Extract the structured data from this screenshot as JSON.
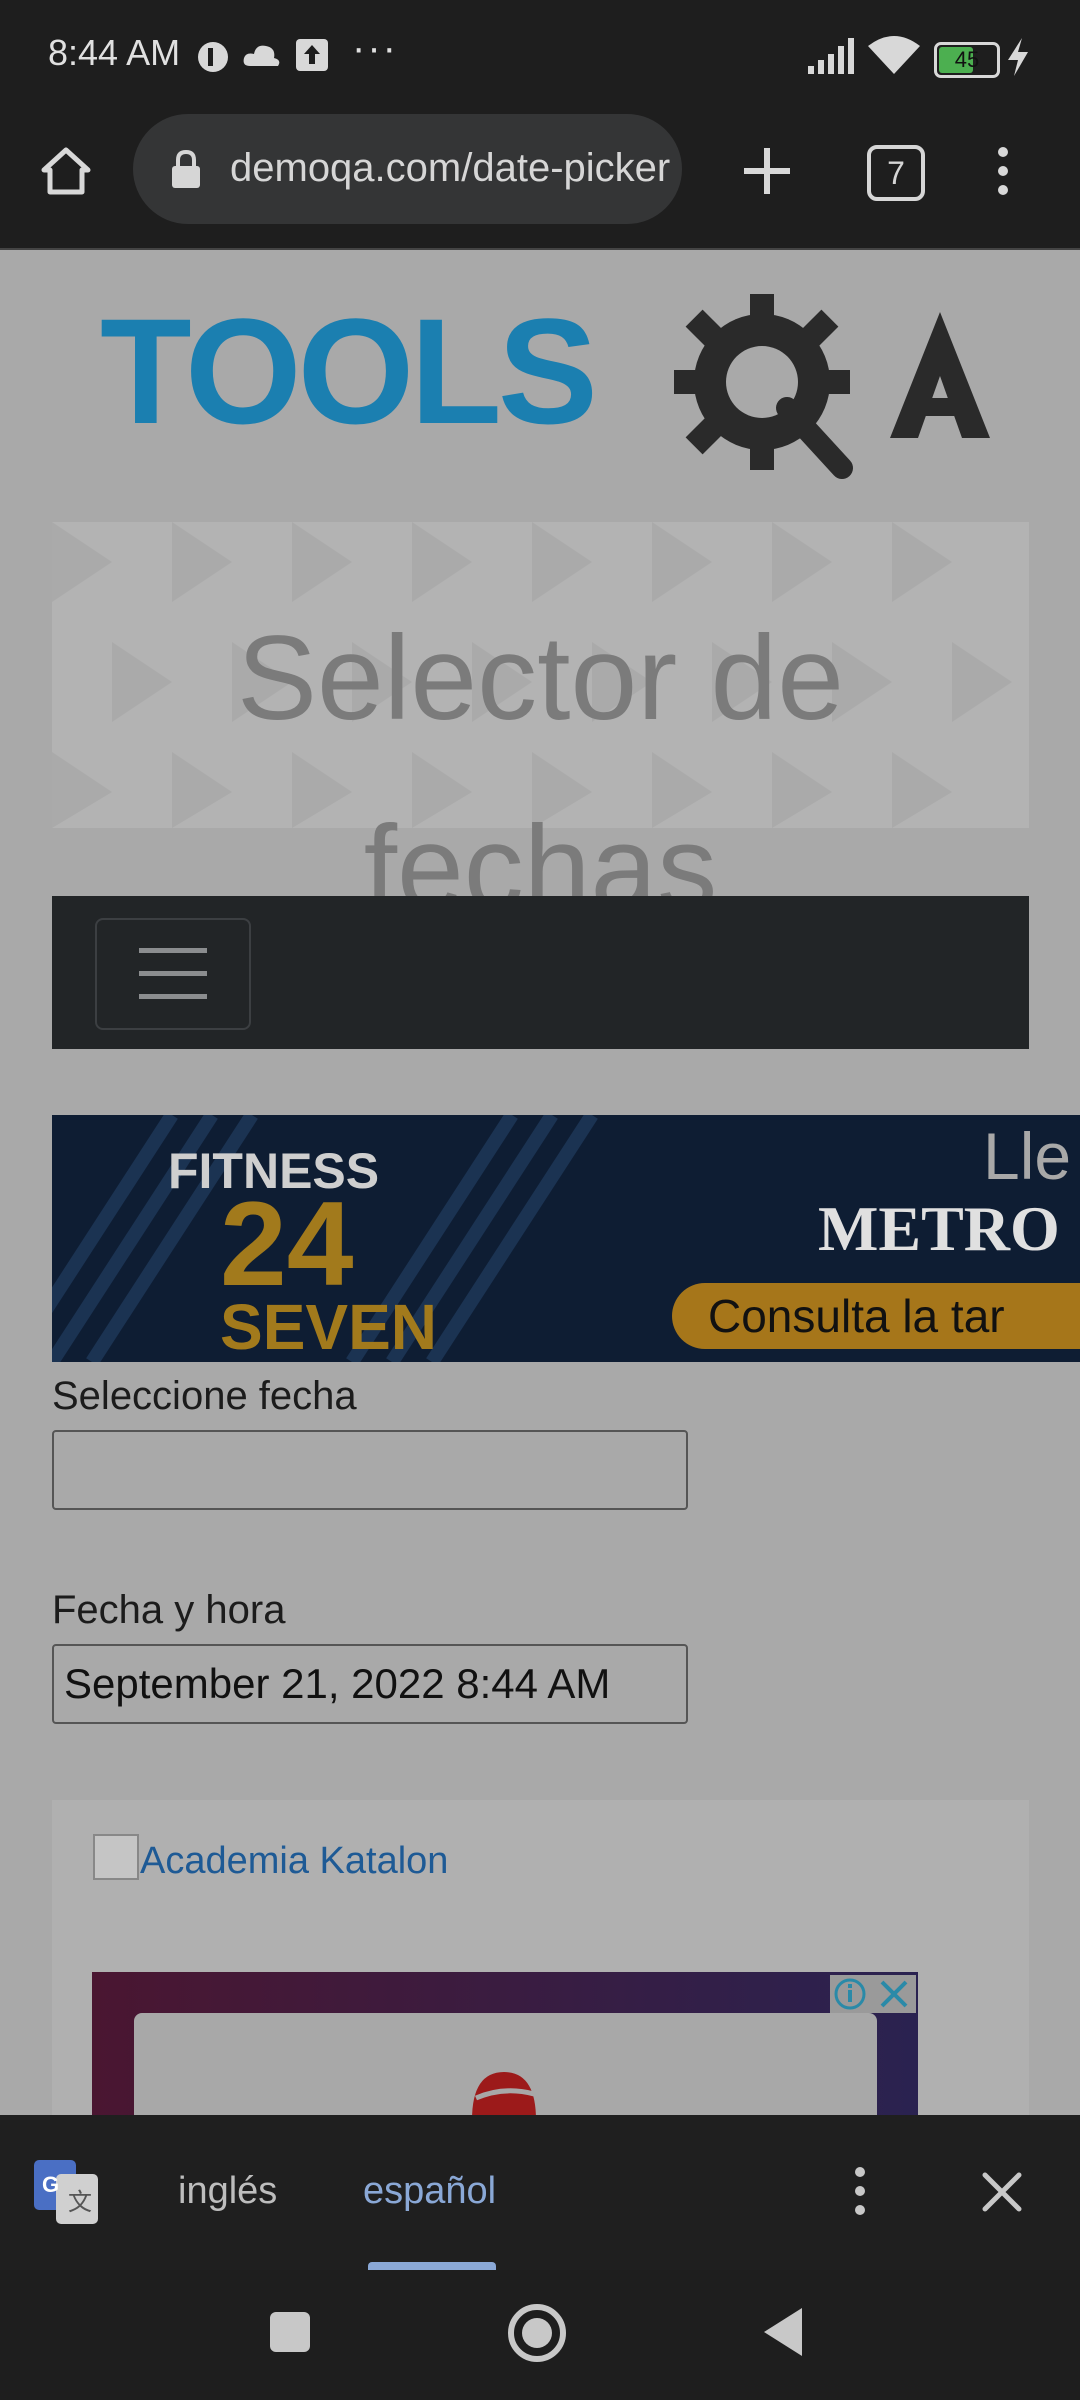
{
  "status_bar": {
    "time": "8:44 AM",
    "more": "···",
    "battery": "45"
  },
  "browser": {
    "url": "demoqa.com/date-picker",
    "tab_count": "7"
  },
  "page": {
    "logo_text": "TOOLS",
    "logo_qa": "QA",
    "title": "Selector de fechas",
    "ad": {
      "brand_line1": "FITNESS",
      "brand_line2": "24",
      "brand_line3": "SEVEN",
      "headline": "Lle",
      "subheadline": "METRO",
      "cta": "Consulta la tar"
    },
    "select_date_label": "Seleccione fecha",
    "select_date_value": "",
    "datetime_label": "Fecha y hora",
    "datetime_value": "September 21, 2022 8:44 AM",
    "katalon_link": "Academia Katalon"
  },
  "translate_bar": {
    "lang_from": "inglés",
    "lang_to": "español"
  },
  "colors": {
    "accent_blue": "#8aa8d6",
    "logo_blue": "#1b7fb0",
    "logo_dark": "#2a2a2a"
  }
}
